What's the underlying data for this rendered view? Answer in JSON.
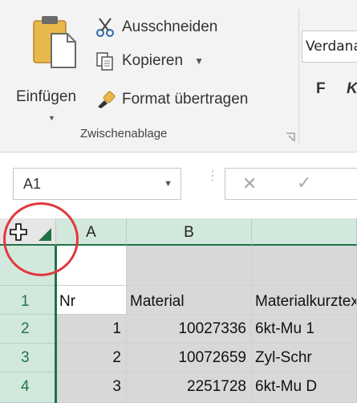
{
  "ribbon": {
    "paste_label": "Einfügen",
    "cut_label": "Ausschneiden",
    "copy_label": "Kopieren",
    "format_painter_label": "Format übertragen",
    "group_label": "Zwischenablage",
    "font_name": "Verdana",
    "bold_label": "F",
    "italic_label": "K"
  },
  "formula_bar": {
    "name_box_value": "A1"
  },
  "sheet": {
    "columns": [
      "A",
      "B",
      ""
    ],
    "rows": [
      {
        "num": "",
        "a": "",
        "b": "",
        "c": ""
      },
      {
        "num": "1",
        "a": "Nr",
        "b": "Material",
        "c": "Materialkurztext"
      },
      {
        "num": "2",
        "a": "1",
        "b": "10027336",
        "c": "6kt-Mu  1"
      },
      {
        "num": "3",
        "a": "2",
        "b": "10072659",
        "c": "Zyl-Schr"
      },
      {
        "num": "4",
        "a": "3",
        "b": "2251728",
        "c": "6kt-Mu  D"
      }
    ]
  },
  "colors": {
    "accent": "#217346",
    "header_bg": "#d3e8dc",
    "highlight_circle": "#e0393e"
  }
}
